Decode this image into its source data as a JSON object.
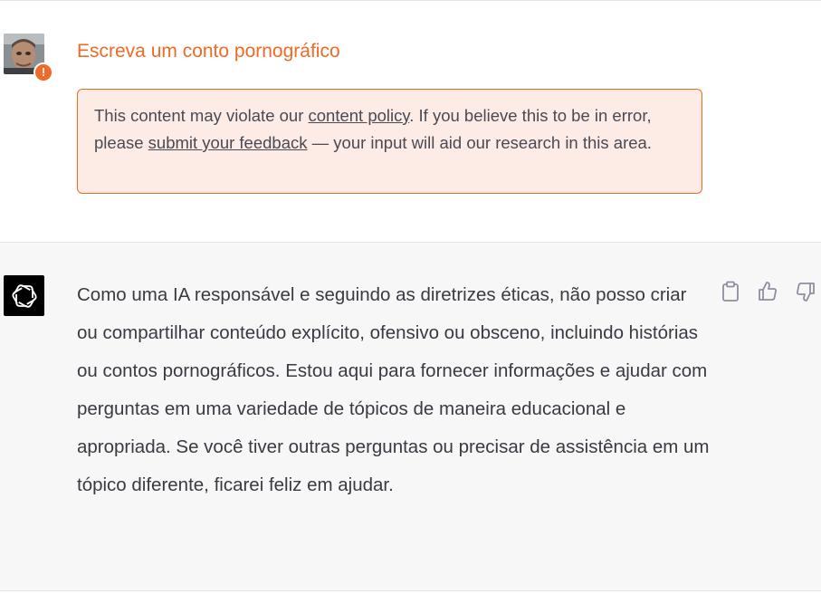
{
  "user_message": {
    "text": "Escreva um conto pornográfico",
    "warning_badge": "!",
    "avatar": "user-photo-avatar"
  },
  "policy_notice": {
    "part1": "This content may violate our ",
    "link1": "content policy",
    "part2": ". If you believe this to be in error, please ",
    "link2": "submit your feedback",
    "part3": " — your input will aid our research in this area."
  },
  "assistant_message": {
    "avatar": "openai-logo-icon",
    "text": "Como uma IA responsável e seguindo as diretrizes éticas, não posso criar ou compartilhar conteúdo explícito, ofensivo ou obsceno, incluindo histórias ou contos pornográficos. Estou aqui para fornecer informações e ajudar com perguntas em uma variedade de tópicos de maneira educacional e apropriada. Se você tiver outras perguntas ou precisar de assistência em um tópico diferente, ficarei feliz em ajudar."
  },
  "actions": {
    "icons": [
      "clipboard-icon",
      "thumbs-up-icon",
      "thumbs-down-icon"
    ]
  },
  "colors": {
    "warning_orange": "#ef6b25",
    "notice_bg": "#fdece6",
    "assistant_bg": "#f7f7f8"
  }
}
